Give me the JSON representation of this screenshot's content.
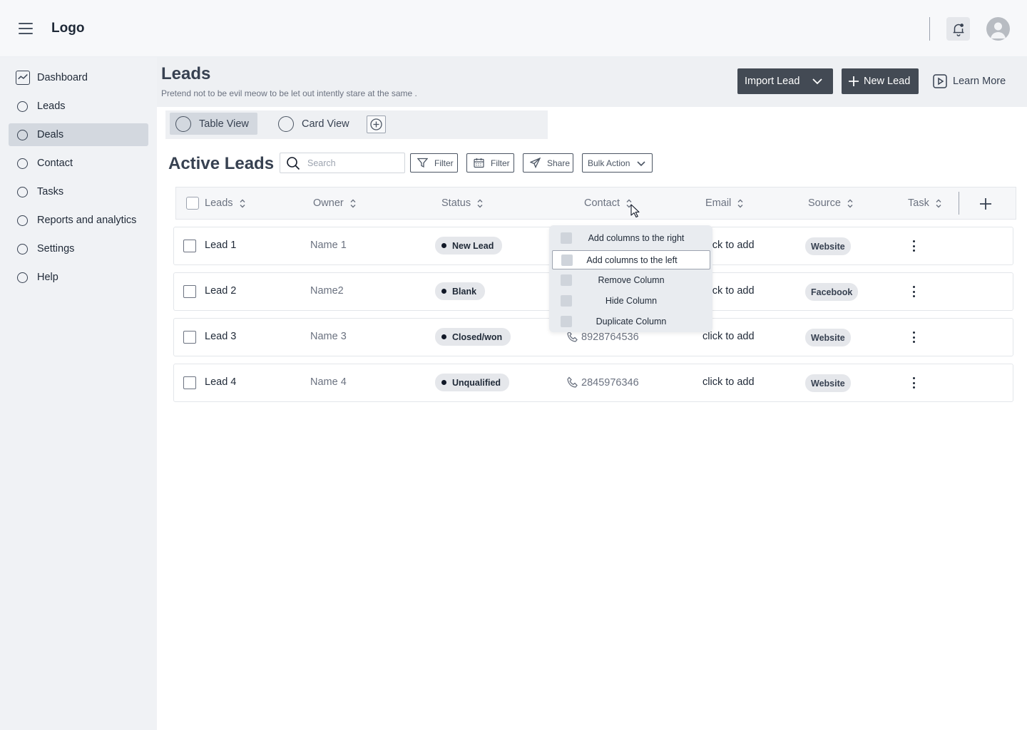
{
  "topbar": {
    "logo": "Logo",
    "icons": {
      "menu": "hamburger-icon",
      "notifications": "bell-icon",
      "avatar": "user-avatar-icon"
    }
  },
  "sidebar": {
    "items": [
      {
        "label": "Dashboard",
        "icon": "chart-icon"
      },
      {
        "label": "Leads",
        "icon": "circle-icon"
      },
      {
        "label": "Deals",
        "icon": "circle-icon",
        "active": true
      },
      {
        "label": "Contact",
        "icon": "circle-icon"
      },
      {
        "label": "Tasks",
        "icon": "circle-icon"
      },
      {
        "label": "Reports and analytics",
        "icon": "circle-icon"
      },
      {
        "label": "Settings",
        "icon": "circle-icon"
      },
      {
        "label": "Help",
        "icon": "circle-icon"
      }
    ]
  },
  "header": {
    "title": "Leads",
    "subtitle": "Pretend not to be evil meow to be let out intently stare at the same .",
    "import_label": "Import Lead",
    "new_label": "New Lead",
    "learn_label": "Learn More"
  },
  "views": {
    "tabs": [
      {
        "label": "Table View",
        "active": true
      },
      {
        "label": "Card View",
        "active": false
      }
    ]
  },
  "toolbar": {
    "section_title": "Active Leads",
    "search_placeholder": "Search",
    "filter1_label": "Filter",
    "filter2_label": "Filter",
    "share_label": "Share",
    "bulk_label": "Bulk Action"
  },
  "table": {
    "columns": [
      "Leads",
      "Owner",
      "Status",
      "Contact",
      "Email",
      "Source",
      "Task"
    ],
    "rows": [
      {
        "lead": "Lead 1",
        "owner": "Name 1",
        "status": "New Lead",
        "contact": "",
        "email": "click to add",
        "source": "Website"
      },
      {
        "lead": "Lead 2",
        "owner": "Name2",
        "status": "Blank",
        "contact": "",
        "email": "click to add",
        "source": "Facebook"
      },
      {
        "lead": "Lead 3",
        "owner": "Name 3",
        "status": "Closed/won",
        "contact": "8928764536",
        "email": "click to add",
        "source": "Website"
      },
      {
        "lead": "Lead 4",
        "owner": "Name 4",
        "status": "Unqualified",
        "contact": "2845976346",
        "email": "click to add",
        "source": "Website"
      }
    ]
  },
  "context_menu": {
    "items": [
      "Add columns to the right",
      "Add columns to the left",
      "Remove Column",
      "Hide Column",
      "Duplicate Column"
    ],
    "highlighted": "Add columns to the left"
  },
  "colors": {
    "dark_button": "#434a54",
    "sidebar_bg": "#f0f2f5",
    "active_item": "#d3d8df",
    "badge_bg": "#e5e7eb"
  }
}
